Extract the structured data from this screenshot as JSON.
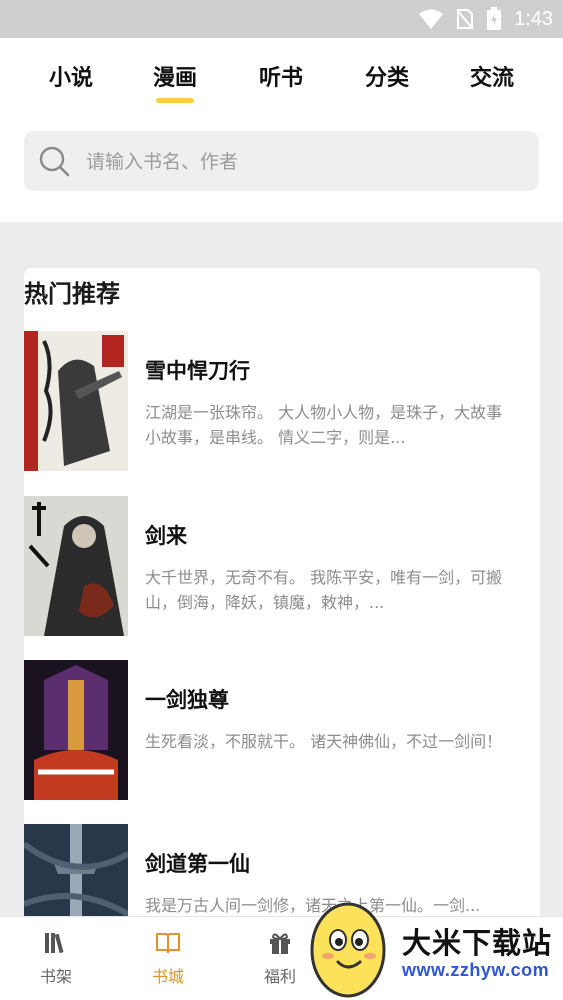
{
  "status_bar": {
    "time": "1:43",
    "icons": [
      "wifi-icon",
      "no-sim-icon",
      "battery-charging-icon"
    ]
  },
  "tabs": [
    {
      "label": "小说",
      "active": false
    },
    {
      "label": "漫画",
      "active": true
    },
    {
      "label": "听书",
      "active": false
    },
    {
      "label": "分类",
      "active": false
    },
    {
      "label": "交流",
      "active": false
    }
  ],
  "search": {
    "placeholder": "请输入书名、作者",
    "icon": "search-icon"
  },
  "section": {
    "title": "热门推荐"
  },
  "books": [
    {
      "title": "雪中悍刀行",
      "desc": "江湖是一张珠帘。 大人物小人物，是珠子，大故事小故事，是串线。 情义二字，则是..."
    },
    {
      "title": "剑来",
      "desc": "大千世界，无奇不有。 我陈平安，唯有一剑，可搬山，倒海，降妖，镇魔，敕神，..."
    },
    {
      "title": "一剑独尊",
      "desc": "生死看淡，不服就干。 诸天神佛仙，不过一剑间！"
    },
    {
      "title": "剑道第一仙",
      "desc": "我是万古人间一剑修，诸天之上第一仙。一剑..."
    }
  ],
  "bottom_nav": [
    {
      "label": "书架",
      "icon": "bookshelf-icon",
      "active": false
    },
    {
      "label": "书城",
      "icon": "open-book-icon",
      "active": true
    },
    {
      "label": "福利",
      "icon": "gift-icon",
      "active": false
    }
  ],
  "watermark": {
    "text": "大米下载站",
    "url": "www.zzhyw.com"
  },
  "colors": {
    "accent": "#f7d03c",
    "active_nav": "#e2922b",
    "url_blue": "#2f56d4"
  }
}
